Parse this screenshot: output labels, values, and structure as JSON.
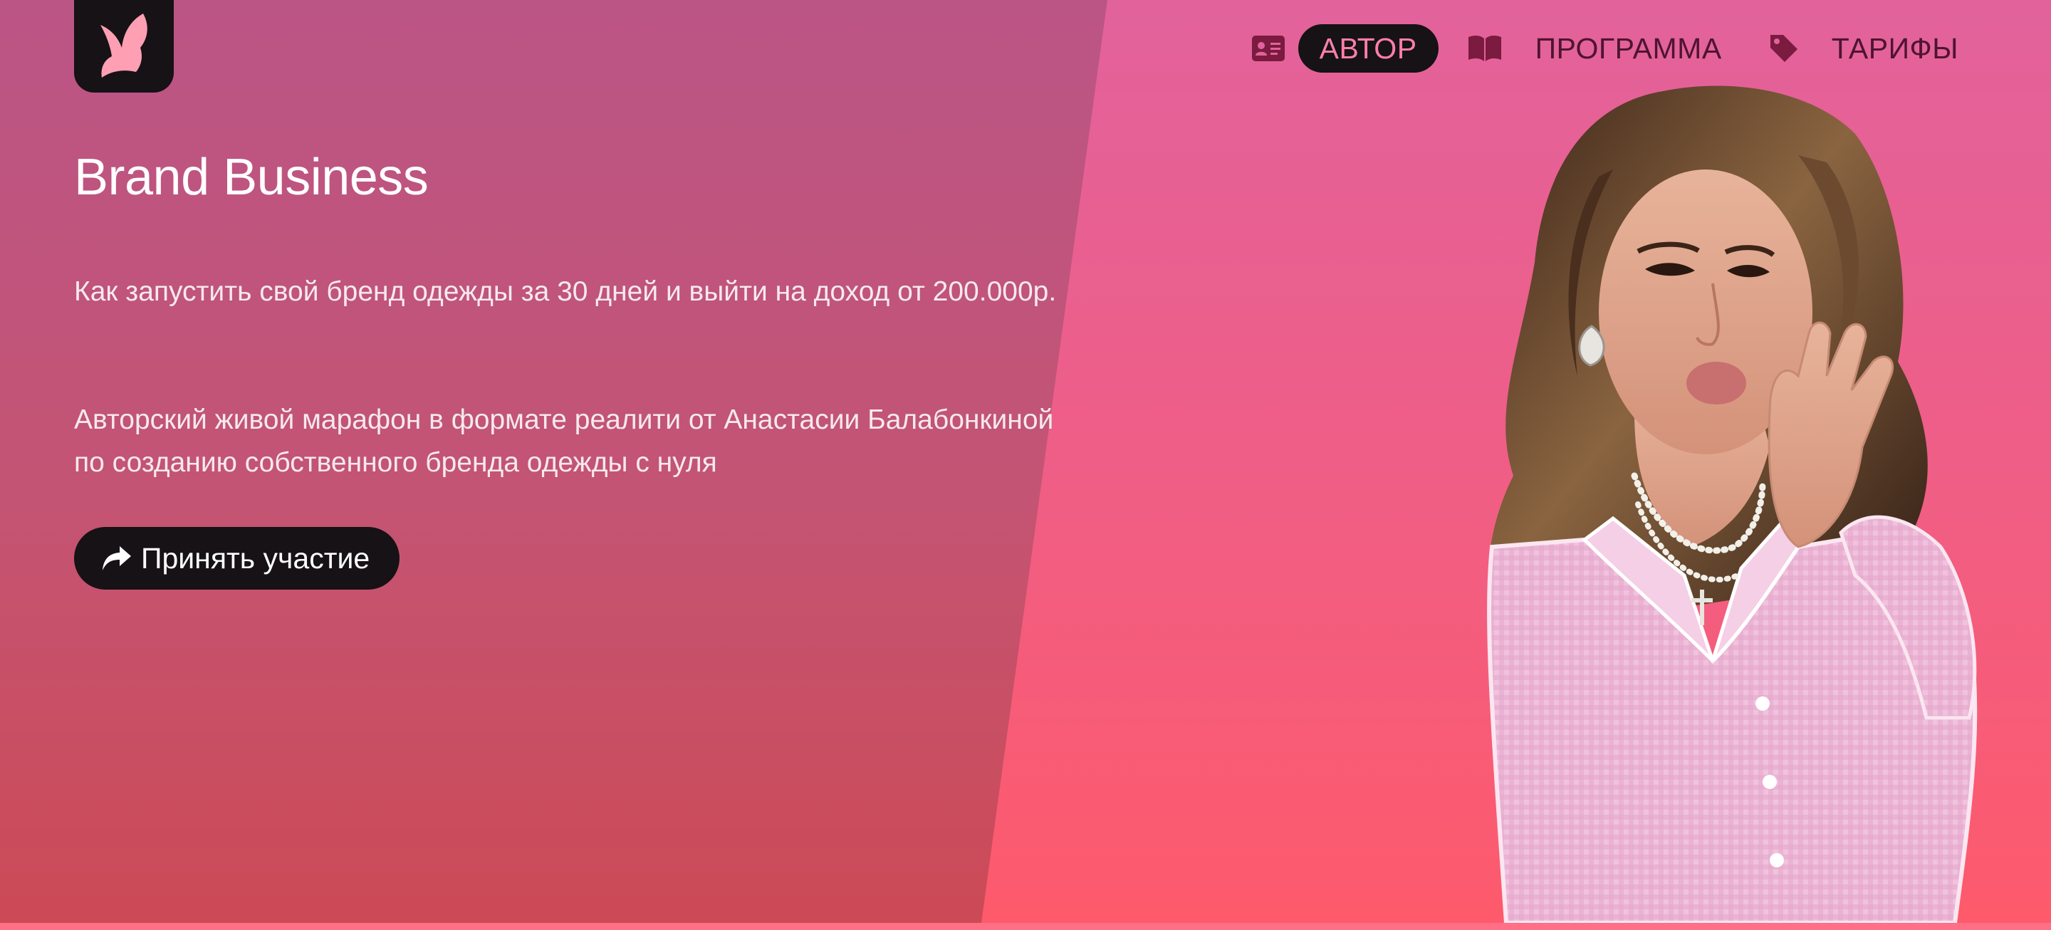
{
  "brand": {
    "logo_icon": "bird-icon"
  },
  "nav": {
    "items": [
      {
        "label": "АВТОР",
        "icon": "id-card-icon",
        "active": true
      },
      {
        "label": "ПРОГРАММА",
        "icon": "book-icon",
        "active": false
      },
      {
        "label": "ТАРИФЫ",
        "icon": "tag-icon",
        "active": false
      }
    ]
  },
  "hero": {
    "title": "Brand Business",
    "paragraph1": "Как запустить свой бренд одежды за 30 дней и выйти на доход от 200.000р.",
    "paragraph2": "Авторский живой марафон в формате реалити от Анастасии Балабонки­ной по созданию собственного бренда одежды с нуля",
    "cta_label": "Принять участие",
    "cta_icon": "share-arrow-icon"
  },
  "colors": {
    "accent_pink": "#ff7fa8",
    "dark": "#161215",
    "nav_text": "#4e1430",
    "left_panel_top": "#bb5586",
    "left_panel_bottom": "#cc4a56",
    "right_bg_top": "#e2629c",
    "right_bg_bottom": "#fe5a6b"
  }
}
